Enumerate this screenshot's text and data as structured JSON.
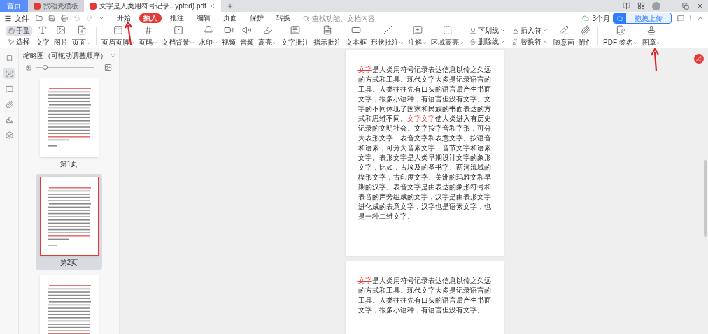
{
  "tabs": [
    {
      "label": "首页",
      "kind": "home",
      "selected": false
    },
    {
      "label": "找稻壳模板",
      "kind": "app",
      "selected": false
    },
    {
      "label": "文字是人类用符号记录...ypted).pdf",
      "kind": "doc",
      "selected": true
    }
  ],
  "menu": {
    "file": "文件",
    "items": [
      {
        "label": "开始",
        "selected": false
      },
      {
        "label": "插入",
        "selected": true
      },
      {
        "label": "批注",
        "selected": false
      },
      {
        "label": "编辑",
        "selected": false
      },
      {
        "label": "页面",
        "selected": false
      },
      {
        "label": "保护",
        "selected": false
      },
      {
        "label": "转换",
        "selected": false
      }
    ],
    "search_placeholder": "查找功能、文档内容",
    "sync": "3个月",
    "upload": "拖拽上传"
  },
  "toolbar": [
    {
      "kind": "stack",
      "items": [
        {
          "label": "手型",
          "selected": true
        },
        {
          "label": "选择",
          "selected": false
        }
      ]
    },
    {
      "kind": "large",
      "label": "文字",
      "dropdown": false
    },
    {
      "kind": "large",
      "label": "图片",
      "dropdown": false
    },
    {
      "kind": "large",
      "label": "页面",
      "dropdown": true
    },
    {
      "kind": "divider"
    },
    {
      "kind": "large",
      "label": "页眉页脚",
      "dropdown": true
    },
    {
      "kind": "large",
      "label": "页码",
      "dropdown": true
    },
    {
      "kind": "large",
      "label": "文档背景",
      "dropdown": true
    },
    {
      "kind": "large",
      "label": "水印",
      "dropdown": true
    },
    {
      "kind": "large",
      "label": "视频",
      "dropdown": false
    },
    {
      "kind": "large",
      "label": "音频",
      "dropdown": false
    },
    {
      "kind": "large",
      "label": "高亮",
      "dropdown": true
    },
    {
      "kind": "large",
      "label": "文字批注",
      "dropdown": false
    },
    {
      "kind": "large",
      "label": "指示批注",
      "dropdown": false
    },
    {
      "kind": "large",
      "label": "文本框",
      "dropdown": false
    },
    {
      "kind": "large",
      "label": "形状批注",
      "dropdown": true
    },
    {
      "kind": "large",
      "label": "注解",
      "dropdown": true
    },
    {
      "kind": "large",
      "label": "区域高亮",
      "dropdown": true
    },
    {
      "kind": "stack",
      "items": [
        {
          "label": "下划线",
          "dropdown": true
        },
        {
          "label": "删除线",
          "dropdown": true
        }
      ]
    },
    {
      "kind": "stack",
      "items": [
        {
          "label": "插入符",
          "dropdown": true
        },
        {
          "label": "替换符",
          "dropdown": true
        }
      ]
    },
    {
      "kind": "large",
      "label": "随意画",
      "dropdown": false
    },
    {
      "kind": "large",
      "label": "附件",
      "dropdown": false
    },
    {
      "kind": "divider"
    },
    {
      "kind": "large",
      "label": "PDF 签名",
      "dropdown": true
    },
    {
      "kind": "large",
      "label": "图章",
      "dropdown": true
    }
  ],
  "sidebar": {
    "icons": [
      {
        "selected": false
      },
      {
        "selected": true
      },
      {
        "selected": false
      },
      {
        "selected": false
      },
      {
        "selected": false
      },
      {
        "selected": false
      }
    ],
    "title": "缩略图（可拖动调整顺序）",
    "zoom": {
      "level": 0.15
    },
    "thumbnails": [
      {
        "label": "第1页",
        "selected": false
      },
      {
        "label": "第2页",
        "selected": true
      },
      {
        "selected": false
      }
    ]
  },
  "pages": [
    {
      "text": "**文字**是人类用符号记录表达信息以传之久远的方式和工具。现代文字大多是记录语言的工具。人类往往先有口头的语言后产生书面文字，很多小语种，有语言但没有文字。文字的不同体现了国家和民族的书面表达的方式和思维不同。**文字文字**使人类进入有历史记录的文明社会。文字按字音和字形，可分为表形文字、表音文字和表意文字。按语音和语素，可分为音素文字、音节文字和语素文字。表形文字是人类早期设计文字的象形文字，比如，古埃及的圣书字、两河流域的楔形文字，古印度文字、美洲的玛雅文和早期的汉字。表音文字是由表达的象形符号和表音的声旁组成的文字，汉字是由表形文字进化成的表意文字，汉字也是语素文字，也是一种二维文字。"
    },
    {
      "text": "**文字**是人类用符号记录表达信息以传之久远的方式和工具。现代文字大多是记录语言的工具。人类往往先有口头的语言后产生书面文字，很多小语种，有语言但没有文字。"
    }
  ]
}
